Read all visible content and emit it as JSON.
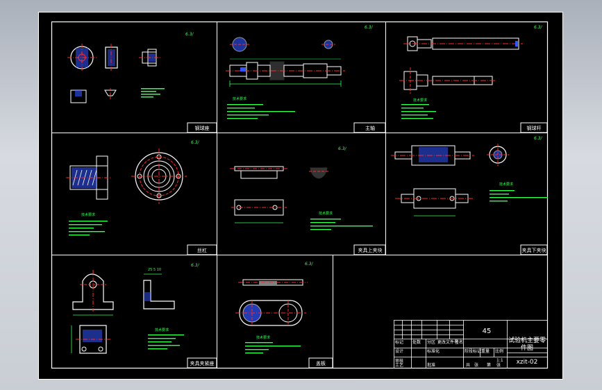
{
  "drawing": {
    "title_block": {
      "material": "45",
      "drawing_title_line1": "试验机主要零",
      "drawing_title_line2": "件图",
      "drawing_code": "xzit-02",
      "row_labels": [
        "标记",
        "处数",
        "分区",
        "更改文件号",
        "签名",
        "年月日"
      ],
      "design_label": "设计",
      "standardize_label": "标准化",
      "stage_label": "阶段标记",
      "weight_label": "重量",
      "scale_label": "比例",
      "review_label": "审核",
      "process_label": "工艺",
      "approve_label": "批准",
      "sheet_labels": [
        "共",
        "张",
        "第",
        "张"
      ],
      "scale_value": "1:1"
    },
    "panels": [
      {
        "caption": "钢球座"
      },
      {
        "caption": "主轴"
      },
      {
        "caption": "钢球杆"
      },
      {
        "caption": "丝杠"
      },
      {
        "caption": "夹具上夹块"
      },
      {
        "caption": "夹具下夹块"
      },
      {
        "caption": "夹具夹紧座"
      },
      {
        "caption": "盖板"
      }
    ],
    "notes_title": "技术要求",
    "roughness_mark": "6.3",
    "colors": {
      "background": "#000000",
      "outline": "#ffffff",
      "centerline": "#ff2a2a",
      "dimension": "#33ff55",
      "hatch": "#3355ff",
      "accent": "#ffe020",
      "frame": "#ffffff"
    }
  }
}
